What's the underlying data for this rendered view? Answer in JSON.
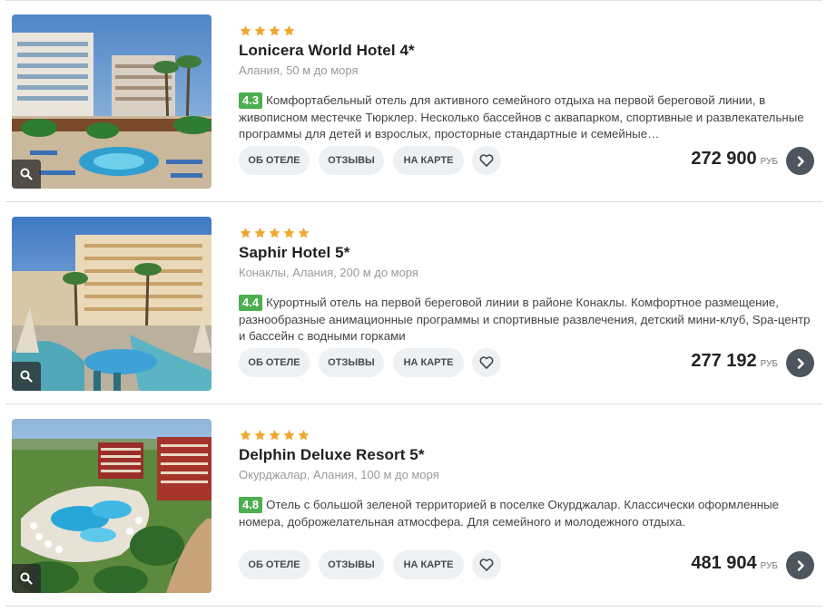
{
  "hotels": [
    {
      "stars": 4,
      "name": "Lonicera World Hotel 4*",
      "location": "Алания, 50 м до моря",
      "rating": "4.3",
      "description": "Комфортабельный отель для активного семейного отдыха на первой береговой линии, в живописном местечке Тюрклер. Несколько бассейнов с аквапарком, спортивные и развлекательные программы для детей и взрослых, просторные стандартные и семейные…",
      "price": "272 900",
      "currency": "РУБ"
    },
    {
      "stars": 5,
      "name": "Saphir Hotel 5*",
      "location": "Конаклы, Алания, 200 м до моря",
      "rating": "4.4",
      "description": "Курортный отель на первой береговой линии в районе Конаклы. Комфортное размещение, разнообразные анимационные программы и спортивные развлечения, детский мини-клуб, Spa-центр и бассейн с водными горками",
      "price": "277 192",
      "currency": "РУБ"
    },
    {
      "stars": 5,
      "name": "Delphin Deluxe Resort 5*",
      "location": "Окурджалар, Алания, 100 м до моря",
      "rating": "4.8",
      "description": "Отель с большой зеленой территорией в поселке Окурджалар. Классически оформленные номера, доброжелательная атмосфера. Для семейного и молодежного отдыха.",
      "price": "481 904",
      "currency": "РУБ"
    }
  ],
  "buttons": {
    "about": "ОБ ОТЕЛЕ",
    "reviews": "ОТЗЫВЫ",
    "map": "НА КАРТЕ"
  },
  "colors": {
    "star": "#f0a830",
    "rating_bg": "#4caf50",
    "go_button": "#4d565e",
    "button_bg": "#eef1f3"
  },
  "icons": {
    "zoom": "search-icon",
    "favorite": "heart-icon",
    "go": "chevron-right-icon",
    "star": "star-icon"
  }
}
